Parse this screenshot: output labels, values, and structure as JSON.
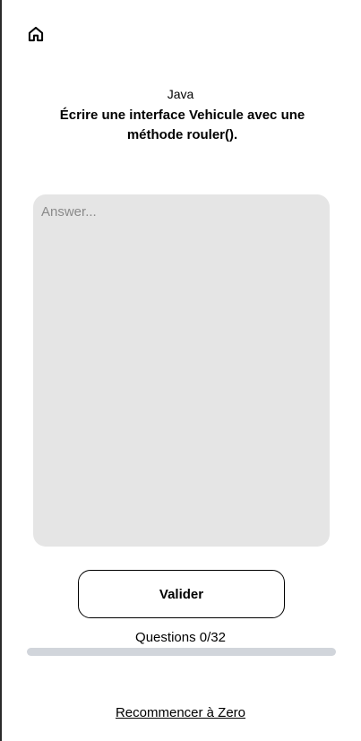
{
  "header": {
    "home_icon": "home-icon"
  },
  "quiz": {
    "subject": "Java",
    "question": "Écrire une interface Vehicule avec une méthode rouler()."
  },
  "answer": {
    "value": "",
    "placeholder": "Answer..."
  },
  "actions": {
    "validate_label": "Valider",
    "restart_label": "Recommencer à Zero"
  },
  "progress": {
    "label": "Questions 0/32",
    "answered": 0,
    "total": 32,
    "fraction": 0,
    "track_color": "#d1d5db"
  }
}
